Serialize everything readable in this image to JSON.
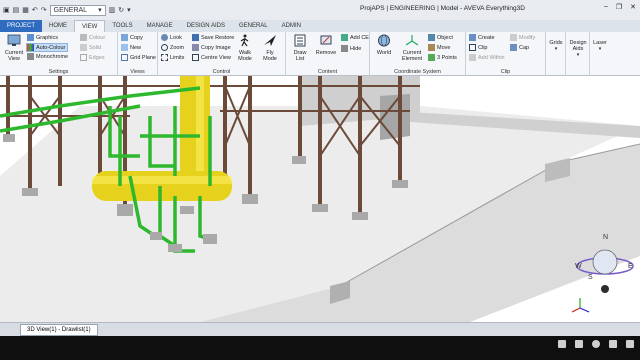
{
  "titlebar": {
    "dropdown_value": "GENERAL",
    "app_title": "ProjAPS | ENGINEERING | Model - AVEVA Everything3D",
    "min": "–",
    "max": "❐",
    "close": "✕"
  },
  "tabs": [
    "PROJECT",
    "HOME",
    "VIEW",
    "TOOLS",
    "MANAGE",
    "DESIGN AIDS",
    "GENERAL",
    "ADMIN"
  ],
  "ribbon": {
    "settings": {
      "current_view": "Current View",
      "graphics": "Graphics",
      "auto_colour": "Auto-Colour",
      "monochrome": "Monochrome",
      "colour": "Colour",
      "solid": "Solid",
      "edges": "Edges",
      "label": "Settings"
    },
    "views": {
      "copy": "Copy",
      "new": "New",
      "grid_plane": "Grid Plane",
      "label": "Views"
    },
    "control": {
      "look": "Look",
      "zoom": "Zoom",
      "limits": "Limits",
      "save_restore": "Save Restore",
      "copy_image": "Copy Image",
      "centre_view": "Centre View",
      "walk_mode": "Walk Mode",
      "fly_mode": "Fly Mode",
      "label": "Control"
    },
    "content": {
      "draw_list": "Draw List",
      "remove": "Remove",
      "add_ce": "Add CE",
      "hide": "Hide",
      "label": "Content"
    },
    "coord": {
      "world": "World",
      "current_element": "Current Element",
      "object": "Object",
      "move": "Move",
      "three_points": "3 Points",
      "label": "Coordinate System"
    },
    "clip": {
      "create": "Create",
      "clip": "Clip",
      "add_within": "Add Within",
      "modify": "Modify",
      "cap": "Cap",
      "label": "Clip"
    },
    "grids": "Grids",
    "design_aids": "Design Aids",
    "laser": "Laser"
  },
  "viewport": {
    "navcube": {
      "n": "N",
      "w": "W",
      "s": "S",
      "e": "E"
    }
  },
  "tabbar": {
    "doc_tab": "3D View(1) - Drawlist(1)"
  },
  "colors": {
    "steel": "#6b4a3a",
    "pipe_green": "#2eb82e",
    "vessel_yellow": "#e6d21c",
    "slab": "#e9e9e9"
  }
}
